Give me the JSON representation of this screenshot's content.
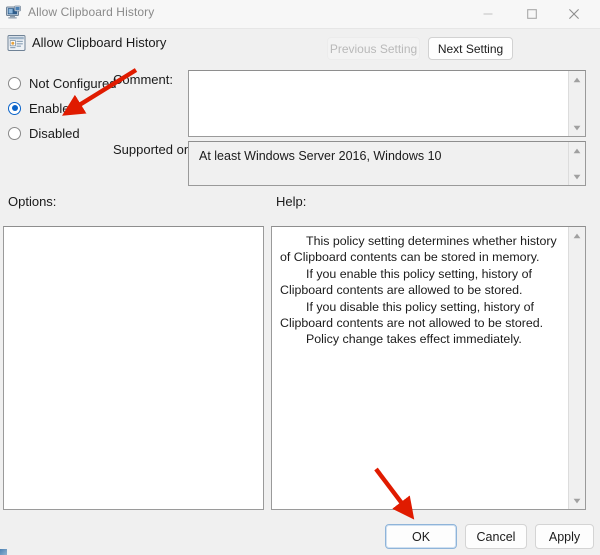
{
  "window": {
    "title": "Allow Clipboard History",
    "icon": "policy-monitor-icon",
    "controls": {
      "minimize": "minimize-icon",
      "maximize": "maximize-icon",
      "close": "close-icon"
    }
  },
  "header": {
    "icon": "policy-setting-icon",
    "title": "Allow Clipboard History",
    "previous_setting_label": "Previous Setting",
    "next_setting_label": "Next Setting",
    "previous_setting_enabled": false,
    "next_setting_enabled": true
  },
  "state": {
    "options": [
      {
        "id": "not-configured",
        "label": "Not Configured",
        "selected": false
      },
      {
        "id": "enabled",
        "label": "Enabled",
        "selected": true
      },
      {
        "id": "disabled",
        "label": "Disabled",
        "selected": false
      }
    ],
    "selected_value": "Enabled"
  },
  "comment": {
    "label": "Comment:",
    "value": "",
    "placeholder": ""
  },
  "supported_on": {
    "label": "Supported on:",
    "value": "At least Windows Server 2016, Windows 10"
  },
  "options_panel": {
    "label": "Options:",
    "content": ""
  },
  "help_panel": {
    "label": "Help:",
    "paragraphs": [
      "This policy setting determines whether history of Clipboard contents can be stored in memory.",
      "If you enable this policy setting, history of Clipboard contents are allowed to be stored.",
      "If you disable this policy setting, history of Clipboard contents are not allowed to be stored.",
      "Policy change takes effect immediately."
    ]
  },
  "footer": {
    "ok_label": "OK",
    "cancel_label": "Cancel",
    "apply_label": "Apply"
  },
  "annotations": [
    {
      "name": "arrow-to-enabled-radio",
      "color": "#e01b00",
      "points_at": "Enabled"
    },
    {
      "name": "arrow-to-ok-button",
      "color": "#e01b00",
      "points_at": "OK"
    }
  ],
  "colors": {
    "accent": "#0a63c9",
    "annotation": "#e01b00",
    "window_bg": "#f0f0f0",
    "field_bg": "#ffffff",
    "border": "#9a9a9a",
    "disabled_text": "#b9b9b9"
  }
}
